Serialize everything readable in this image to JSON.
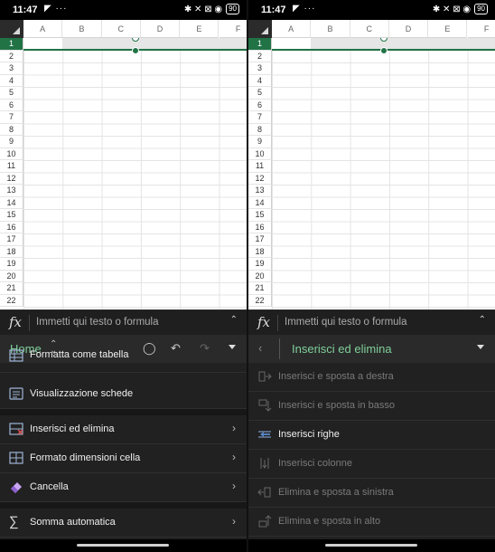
{
  "status": {
    "time": "11:47",
    "left_icons": [
      "telegram-icon",
      "more-dots-icon"
    ],
    "left_glyphs": "◤ ···",
    "right_icons": [
      "bluetooth-icon",
      "mute-icon",
      "screen-icon",
      "wifi-icon",
      "battery-icon"
    ],
    "right_glyphs": "✱ ✕ ⊠ ◉",
    "battery": "90"
  },
  "grid": {
    "columns": [
      "A",
      "B",
      "C",
      "D",
      "E",
      "F"
    ],
    "rows": [
      "1",
      "2",
      "3",
      "4",
      "5",
      "6",
      "7",
      "8",
      "9",
      "10",
      "11",
      "12",
      "13",
      "14",
      "15",
      "16",
      "17",
      "18",
      "19",
      "20",
      "21",
      "22"
    ],
    "selected_row": "1"
  },
  "formula_bar": {
    "fx": "fx",
    "placeholder": "Immetti qui testo o formula",
    "chevron": "⌃"
  },
  "left": {
    "ribbon": {
      "title": "Home",
      "updown": "⌃⌄",
      "icons": [
        "lightbulb-icon",
        "undo-icon",
        "redo-icon"
      ],
      "glyphs": [
        "💡",
        "↶",
        "↷"
      ]
    },
    "menu": [
      {
        "label": "Formatta come tabella",
        "icon": "table-icon"
      },
      {
        "label": "Visualizzazione schede",
        "icon": "card-view-icon"
      },
      {
        "label": "Inserisci ed elimina",
        "icon": "insert-delete-icon",
        "arrow": "›"
      },
      {
        "label": "Formato dimensioni cella",
        "icon": "cell-size-icon",
        "arrow": "›"
      },
      {
        "label": "Cancella",
        "icon": "eraser-icon",
        "arrow": "›"
      },
      {
        "label": "Somma automatica",
        "icon": "sigma-icon",
        "arrow": "›"
      }
    ]
  },
  "right": {
    "ribbon": {
      "back": "‹",
      "title": "Inserisci ed elimina"
    },
    "menu": [
      {
        "label": "Inserisci e sposta a destra",
        "icon": "shift-right-icon",
        "enabled": false
      },
      {
        "label": "Inserisci e sposta in basso",
        "icon": "shift-down-icon",
        "enabled": false
      },
      {
        "label": "Inserisci righe",
        "icon": "insert-rows-icon",
        "enabled": true
      },
      {
        "label": "Inserisci colonne",
        "icon": "insert-columns-icon",
        "enabled": false
      },
      {
        "label": "Elimina e sposta a sinistra",
        "icon": "shift-left-icon",
        "enabled": false
      },
      {
        "label": "Elimina e sposta in alto",
        "icon": "shift-up-icon",
        "enabled": false
      }
    ]
  },
  "colors": {
    "accent": "#217346",
    "ribbon_title": "#7fcf9a",
    "menu_bg": "#212121"
  }
}
